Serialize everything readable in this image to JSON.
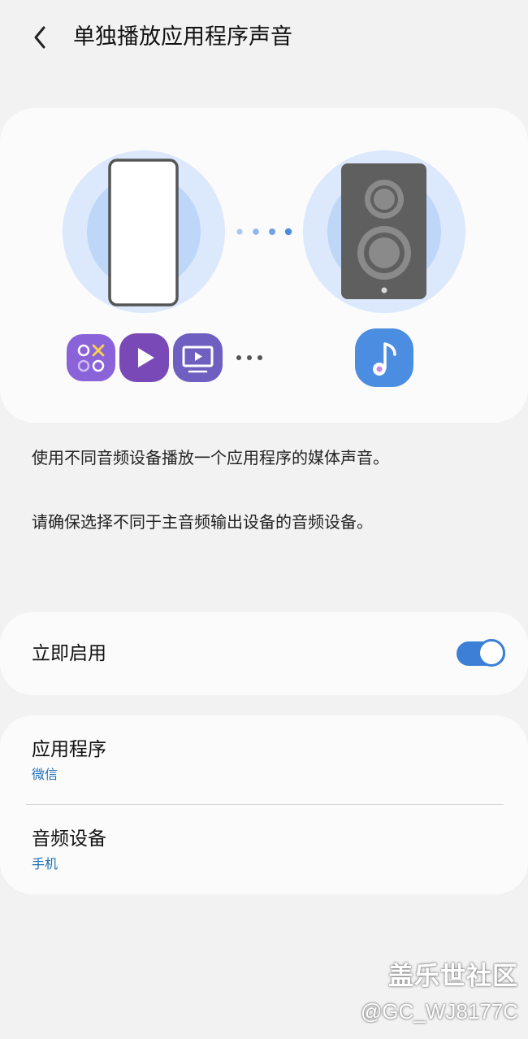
{
  "header": {
    "title": "单独播放应用程序声音",
    "back_icon": "chevron-left-icon"
  },
  "illustration": {
    "icons": [
      "phone-icon",
      "speaker-icon",
      "game-launcher-icon",
      "video-play-icon",
      "tv-icon",
      "more-dots-icon",
      "music-note-icon"
    ],
    "colors": {
      "halo_outer": "#dbe8fb",
      "halo_inner": "#bfd7f7",
      "speaker": "#5f5f5f",
      "app_purple": "#7d5bc8",
      "music_blue": "#4b8de0"
    }
  },
  "descriptions": {
    "line1": "使用不同音频设备播放一个应用程序的媒体声音。",
    "line2": "请确保选择不同于主音频输出设备的音频设备。"
  },
  "toggle": {
    "label": "立即启用",
    "state": "on",
    "accent": "#3b80d6"
  },
  "settings": [
    {
      "title": "应用程序",
      "value": "微信"
    },
    {
      "title": "音频设备",
      "value": "手机"
    }
  ],
  "watermark": {
    "line1": "盖乐世社区",
    "line2": "@GC_WJ8177C"
  }
}
